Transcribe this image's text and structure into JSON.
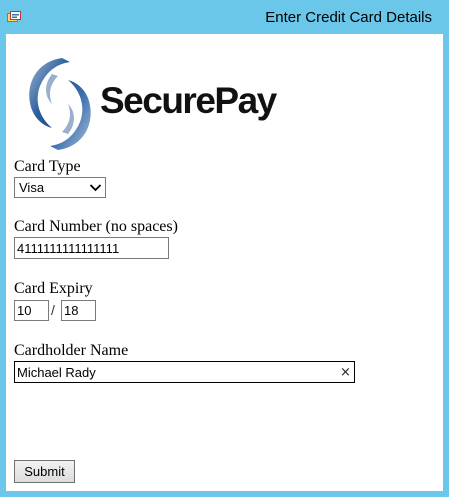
{
  "window": {
    "title": "Enter Credit Card Details",
    "app_icon": "form-window-icon",
    "titlebar_color": "#6ac7ea"
  },
  "logo": {
    "text": "SecurePay",
    "icon": "securepay-swirl-logo",
    "swirl_color": "#2a5f9e"
  },
  "form": {
    "card_type": {
      "label": "Card Type",
      "value": "Visa"
    },
    "card_number": {
      "label": "Card Number (no spaces)",
      "value": "4111111111111111"
    },
    "card_expiry": {
      "label": "Card Expiry",
      "month": "10",
      "separator": "/",
      "year": "18"
    },
    "cardholder_name": {
      "label": "Cardholder Name",
      "value": "Michael Rady",
      "clear_glyph": "×"
    },
    "submit_label": "Submit"
  }
}
